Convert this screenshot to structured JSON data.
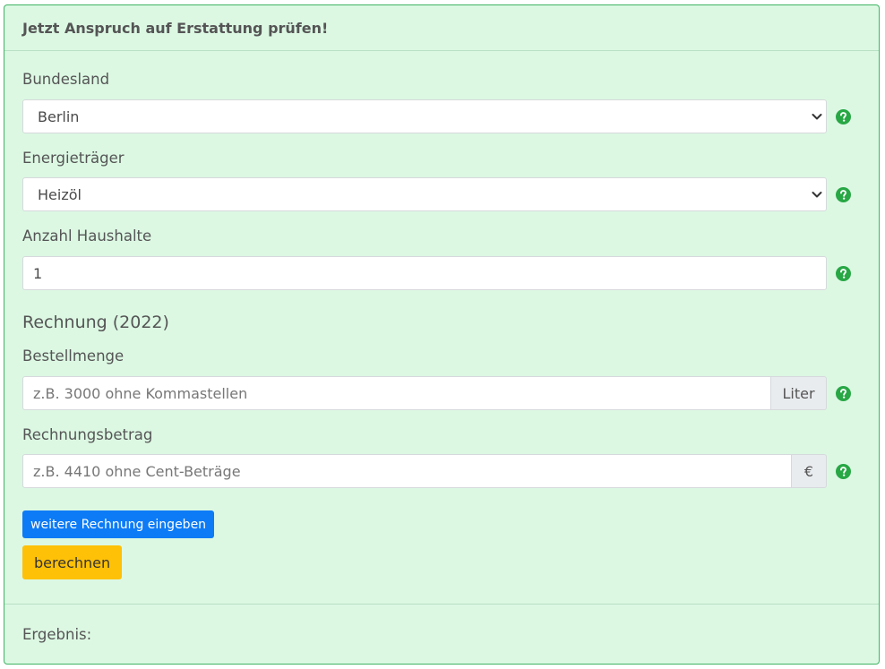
{
  "header": {
    "title": "Jetzt Anspruch auf Erstattung prüfen!"
  },
  "form": {
    "bundesland": {
      "label": "Bundesland",
      "value": "Berlin"
    },
    "energietraeger": {
      "label": "Energieträger",
      "value": "Heizöl"
    },
    "haushalte": {
      "label": "Anzahl Haushalte",
      "value": "1"
    },
    "section_heading": "Rechnung (2022)",
    "bestellmenge": {
      "label": "Bestellmenge",
      "placeholder": "z.B. 3000 ohne Kommastellen",
      "unit": "Liter"
    },
    "rechnungsbetrag": {
      "label": "Rechnungsbetrag",
      "placeholder": "z.B. 4410 ohne Cent-Beträge",
      "unit": "€"
    },
    "add_invoice_button": "weitere Rechnung eingeben",
    "calculate_button": "berechnen"
  },
  "footer": {
    "result_label": "Ergebnis:"
  },
  "colors": {
    "card_background": "#dcf8e3",
    "card_border": "#3fb464",
    "help_icon": "#28a745",
    "primary_button": "#0d7bf6",
    "warning_button": "#ffc107"
  },
  "icons": {
    "help": "question-circle-icon",
    "select_caret": "chevron-down-icon"
  }
}
